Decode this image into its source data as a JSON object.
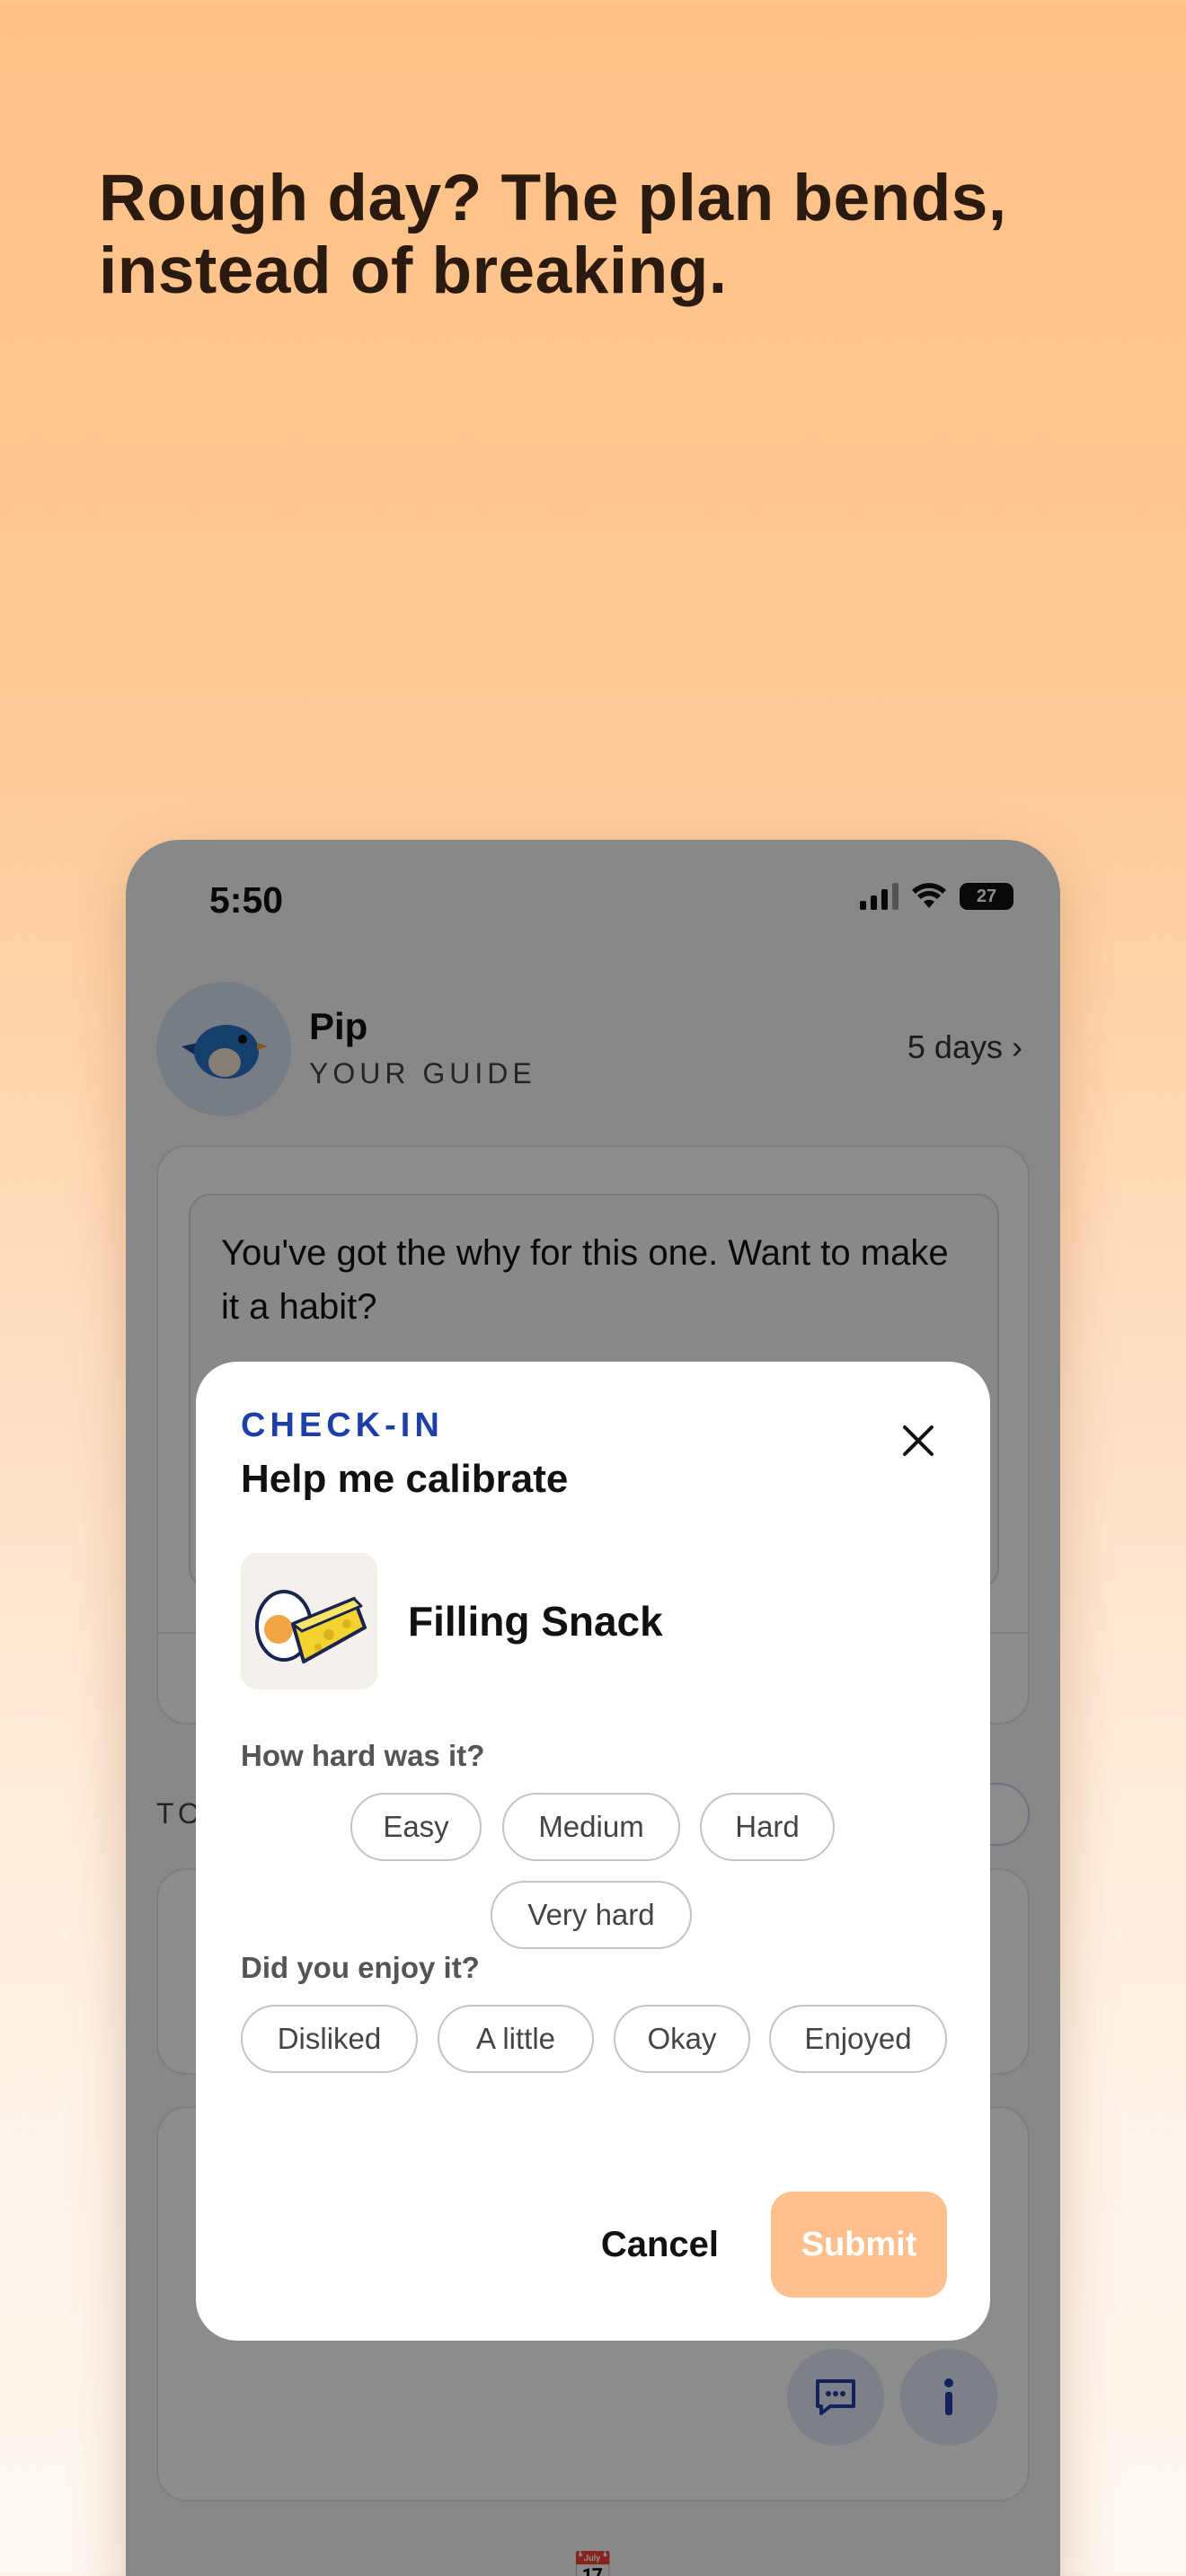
{
  "headline": "Rough day? The plan bends, instead of breaking.",
  "status_bar": {
    "time": "5:50",
    "battery": "27"
  },
  "guide": {
    "name": "Pip",
    "role": "YOUR GUIDE",
    "streak": "5 days"
  },
  "message": {
    "text": "You've got the why for this one. Want to make it a habit?"
  },
  "modal": {
    "eyebrow": "CHECK-IN",
    "title": "Help me calibrate",
    "item_name": "Filling Snack",
    "difficulty_question": "How hard was it?",
    "difficulty_options": [
      "Easy",
      "Medium",
      "Hard",
      "Very hard"
    ],
    "enjoy_question": "Did you enjoy it?",
    "enjoy_options": [
      "Disliked",
      "A little",
      "Okay",
      "Enjoyed"
    ],
    "cancel_label": "Cancel",
    "submit_label": "Submit"
  },
  "colors": {
    "accent": "#1f3fa8",
    "submit": "#ffbf8c",
    "background_top": "#ffc186"
  }
}
